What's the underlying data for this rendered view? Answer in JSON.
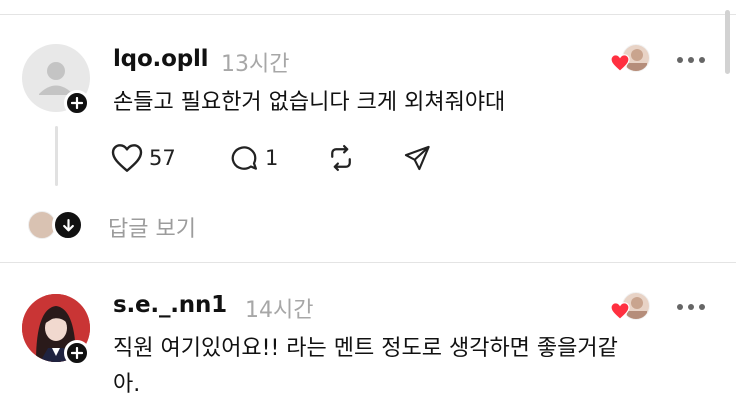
{
  "posts": [
    {
      "username": "lqo.opll",
      "time": "13시간",
      "text": "손들고 필요한거 없습니다 크게 외쳐줘야대",
      "like_count": "57",
      "comment_count": "1",
      "view_replies": "답글 보기"
    },
    {
      "username": "s.e._.nn1",
      "time": "14시간",
      "text_line1": "직원 여기있어요!! 라는 멘트 정도로 생각하면 좋을거같",
      "text_line2": "아."
    }
  ],
  "colors": {
    "heart": "#ff3040",
    "muted": "#a7a7a7",
    "text": "#111111"
  },
  "icons": [
    "user-placeholder-icon",
    "plus-icon",
    "heart-icon",
    "comment-icon",
    "repost-icon",
    "share-icon",
    "more-icon",
    "arrow-down-icon"
  ]
}
